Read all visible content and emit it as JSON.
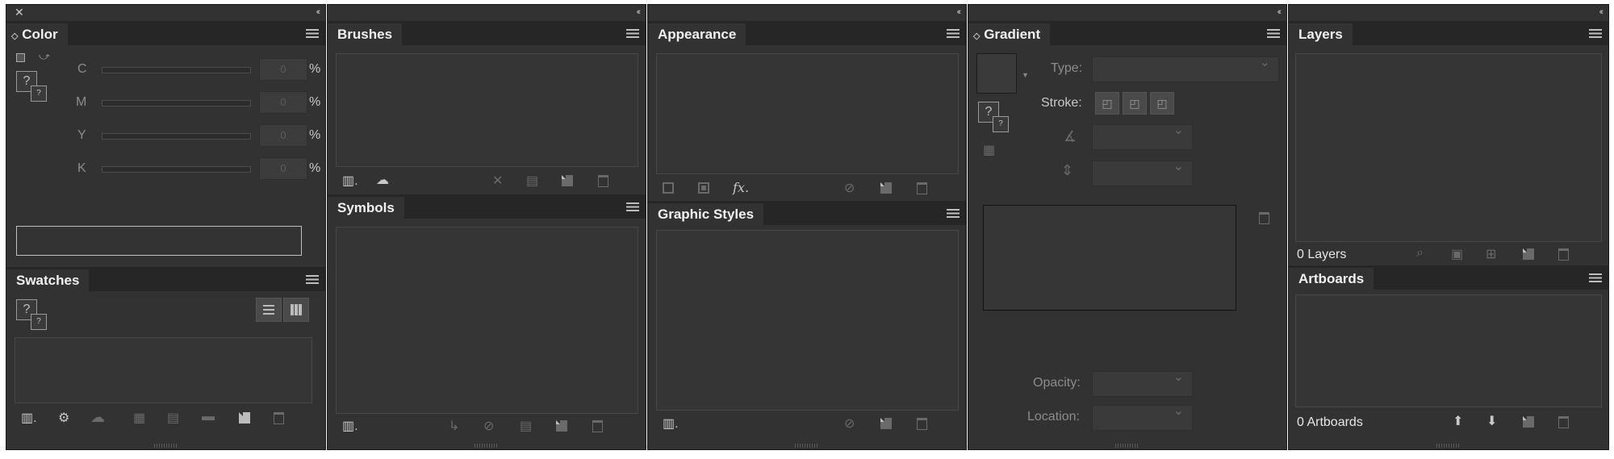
{
  "color_panel": {
    "title": "Color",
    "channels": [
      {
        "label": "C",
        "value": "0",
        "unit": "%"
      },
      {
        "label": "M",
        "value": "0",
        "unit": "%"
      },
      {
        "label": "Y",
        "value": "0",
        "unit": "%"
      },
      {
        "label": "K",
        "value": "0",
        "unit": "%"
      }
    ],
    "unknown_glyph": "?"
  },
  "swatches_panel": {
    "title": "Swatches",
    "unknown_glyph": "?"
  },
  "brushes_panel": {
    "title": "Brushes"
  },
  "symbols_panel": {
    "title": "Symbols"
  },
  "appearance_panel": {
    "title": "Appearance",
    "fx_label": "fx"
  },
  "graphic_styles_panel": {
    "title": "Graphic Styles"
  },
  "gradient_panel": {
    "title": "Gradient",
    "type_label": "Type:",
    "stroke_label": "Stroke:",
    "opacity_label": "Opacity:",
    "location_label": "Location:",
    "unknown_glyph": "?"
  },
  "layers_panel": {
    "title": "Layers",
    "count_label": "0 Layers"
  },
  "artboards_panel": {
    "title": "Artboards",
    "count_label": "0 Artboards"
  },
  "icons": {
    "close": "close-icon",
    "collapse": "collapse-icon",
    "menu": "panel-menu-icon",
    "trash": "trash-icon",
    "new": "new-item-icon",
    "library": "library-icon"
  },
  "colors": {
    "panel_bg": "#323232",
    "tab_bar_bg": "#262626",
    "text": "#f0f0f0",
    "dim_text": "#8c8c8c"
  }
}
